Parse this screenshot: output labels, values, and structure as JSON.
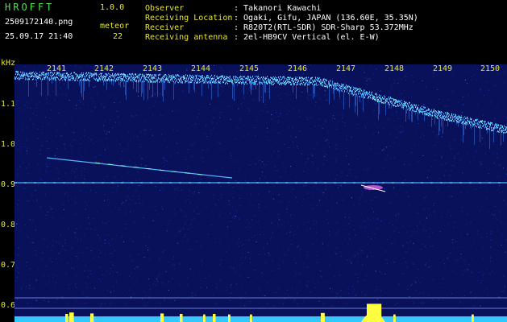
{
  "header": {
    "logo": "HROFFT",
    "version": "1.0.0",
    "filename": "2509172140.png",
    "datetime": "25.09.17 21:40",
    "meteor_label": "meteor",
    "meteor_count": "22",
    "observer_label": "Observer",
    "observer_value": ": Takanori Kawachi",
    "location_label": "Receiving Location",
    "location_value": ": Ogaki, Gifu, JAPAN (136.60E, 35.35N)",
    "receiver_label": "Receiver",
    "receiver_value": ": R820T2(RTL-SDR) SDR-Sharp 53.372MHz",
    "antenna_label": "Receiving antenna",
    "antenna_value": ": 2el-HB9CV Vertical (el. E-W)"
  },
  "plot": {
    "unit": "kHz",
    "x_ticks": [
      "2141",
      "2142",
      "2143",
      "2144",
      "2145",
      "2146",
      "2147",
      "2148",
      "2149",
      "2150"
    ],
    "y_ticks": [
      "1.1",
      "1.0",
      "0.9",
      "0.8",
      "0.7",
      "0.6"
    ],
    "colors": {
      "background": "#08115a",
      "noise": "#2040c0",
      "signal": "#7fe0ff",
      "meteor": "#b0ffb0",
      "bottom_bar": "#30c8ff",
      "burst": "#ffff40"
    }
  }
}
